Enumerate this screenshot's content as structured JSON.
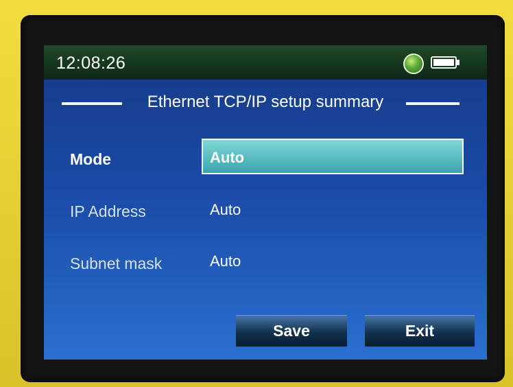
{
  "status_bar": {
    "time": "12:08:26",
    "network_icon": "globe-icon",
    "battery_icon": "battery-icon"
  },
  "header": {
    "title": "Ethernet TCP/IP setup summary"
  },
  "fields": [
    {
      "label": "Mode",
      "value": "Auto",
      "selected": true
    },
    {
      "label": "IP Address",
      "value": "Auto",
      "selected": false
    },
    {
      "label": "Subnet mask",
      "value": "Auto",
      "selected": false
    }
  ],
  "buttons": {
    "save_label": "Save",
    "exit_label": "Exit"
  },
  "colors": {
    "screen_background": "#1a4aa6",
    "status_bar": "#1f4a2a",
    "selected_field": "#3aa3b0",
    "device_case": "#e8d23a"
  }
}
